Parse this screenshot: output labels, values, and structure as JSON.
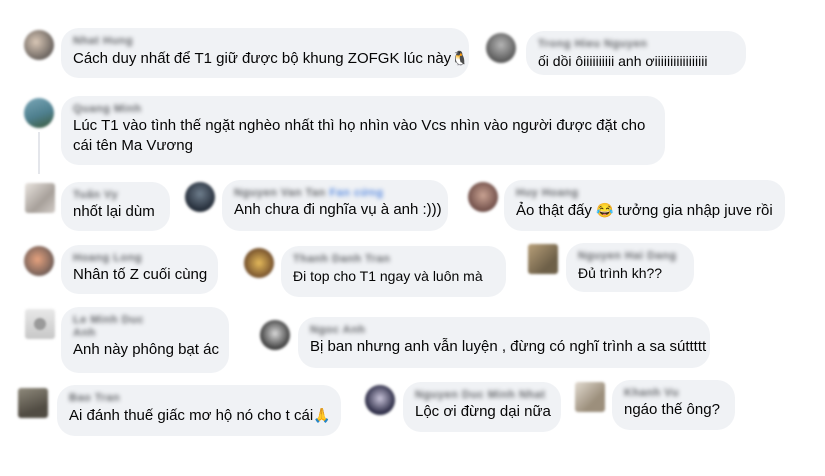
{
  "comments": [
    {
      "name": "Nhat Hung",
      "text": "Cách duy nhất để T1 giữ được bộ khung ZOFGK lúc này",
      "emoji": "🐧"
    },
    {
      "name": "Trong Hieu Nguyen",
      "text": "ối dồi ôiiiiiiiiii anh ơiiiiiiiiiiiiiiiii",
      "emoji": ""
    },
    {
      "name": "Quang Minh",
      "text": "Lúc T1 vào tình thế ngặt nghèo nhất thì họ nhìn vào Vcs nhìn vào người được đặt cho cái tên Ma Vương",
      "emoji": ""
    },
    {
      "name": "Tuấn Vy",
      "text": "nhốt lại dùm",
      "emoji": ""
    },
    {
      "name": "Nguyen Van Tan",
      "badge": "Fan cứng",
      "text": "Anh chưa đi nghĩa vụ à anh :)))",
      "emoji": ""
    },
    {
      "name": "Huy Hoang",
      "text": "Ảo thật đấy",
      "emoji": "😂",
      "text_after": "tưởng gia nhập juve rồi"
    },
    {
      "name": "Hoang Long",
      "text": "Nhân tố Z cuối cùng",
      "emoji": ""
    },
    {
      "name": "Thanh Danh Tran",
      "text": "Đi top cho T1 ngay và luôn mà",
      "emoji": ""
    },
    {
      "name": "Nguyen Hai Dang",
      "text": "Đủ trình kh??",
      "emoji": ""
    },
    {
      "name": "Le Minh Duc Anh",
      "text": "Anh này phông bạt ác",
      "emoji": ""
    },
    {
      "name": "Ngoc Anh",
      "text": "Bị ban nhưng anh vẫn luyện , đừng có nghĩ trình a sa súttttt",
      "emoji": ""
    },
    {
      "name": "Bao Tran",
      "text": "Ai đánh thuế giấc mơ hộ nó cho t cái",
      "emoji": "🙏"
    },
    {
      "name": "Nguyen Duc Minh Nhat",
      "text": "Lộc ơi đừng dại nữa",
      "emoji": ""
    },
    {
      "name": "Khanh Vu",
      "text": "ngáo thế ông?",
      "emoji": ""
    }
  ]
}
